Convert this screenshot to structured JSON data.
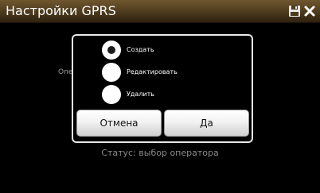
{
  "window": {
    "title": "Настройки GPRS",
    "save_icon": "floppy-disk-icon",
    "close_icon": "close-x-icon"
  },
  "background": {
    "label_fragment": "Опе",
    "status": "Статус: выбор оператора"
  },
  "dialog": {
    "options": [
      {
        "label": "Создать",
        "selected": true
      },
      {
        "label": "Редактировать",
        "selected": false
      },
      {
        "label": "Удалить",
        "selected": false
      }
    ],
    "cancel_label": "Отмена",
    "ok_label": "Да"
  },
  "colors": {
    "title_bar": "#4c3a1e",
    "background": "#000000",
    "dialog_border": "#e8e8e8",
    "button_face": "#f2f2f2"
  }
}
